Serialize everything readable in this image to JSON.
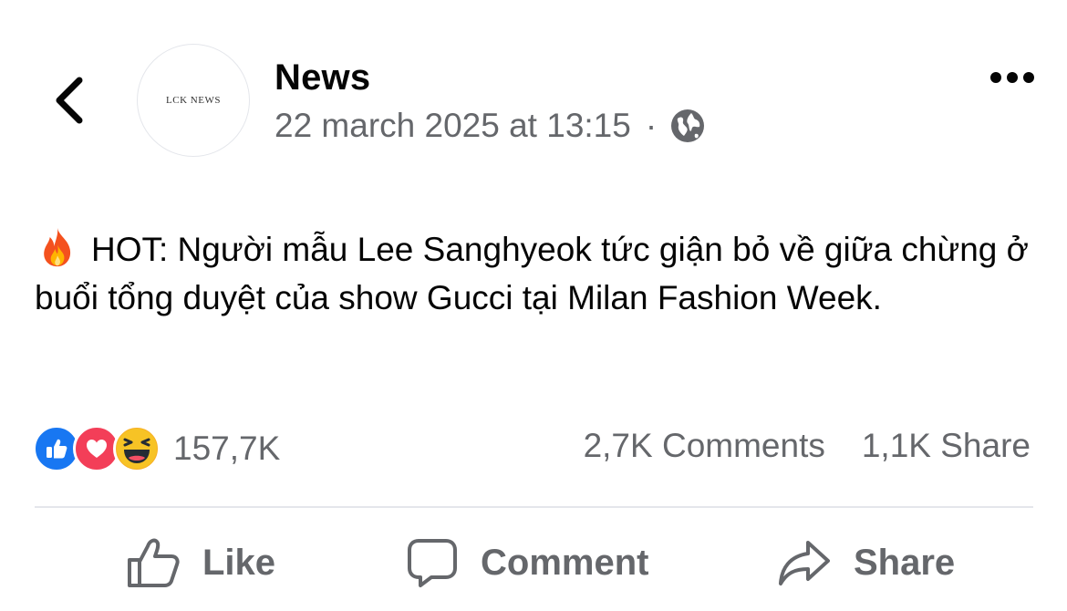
{
  "post": {
    "page_name": "News",
    "avatar_text": "LCK NEWS",
    "timestamp": "22 march 2025 at 13:15",
    "separator": "·",
    "audience_icon": "globe-icon",
    "text_icon": "fire-emoji",
    "text": "HOT: Người mẫu Lee Sanghyeok tức giận bỏ về giữa chừng ở buổi tổng duyệt của show Gucci tại Milan Fashion Week."
  },
  "reactions": {
    "icons": [
      "like-reaction",
      "love-reaction",
      "haha-reaction"
    ],
    "count": "157,7K"
  },
  "stats": {
    "comments": "2,7K Comments",
    "shares": "1,1K Share"
  },
  "actions": {
    "like": "Like",
    "comment": "Comment",
    "share": "Share"
  },
  "colors": {
    "text": "#050505",
    "secondary": "#65676b",
    "like_blue": "#1877f2",
    "love_red": "#f33e58",
    "haha_yellow": "#f7b125",
    "divider": "#e4e6eb"
  }
}
